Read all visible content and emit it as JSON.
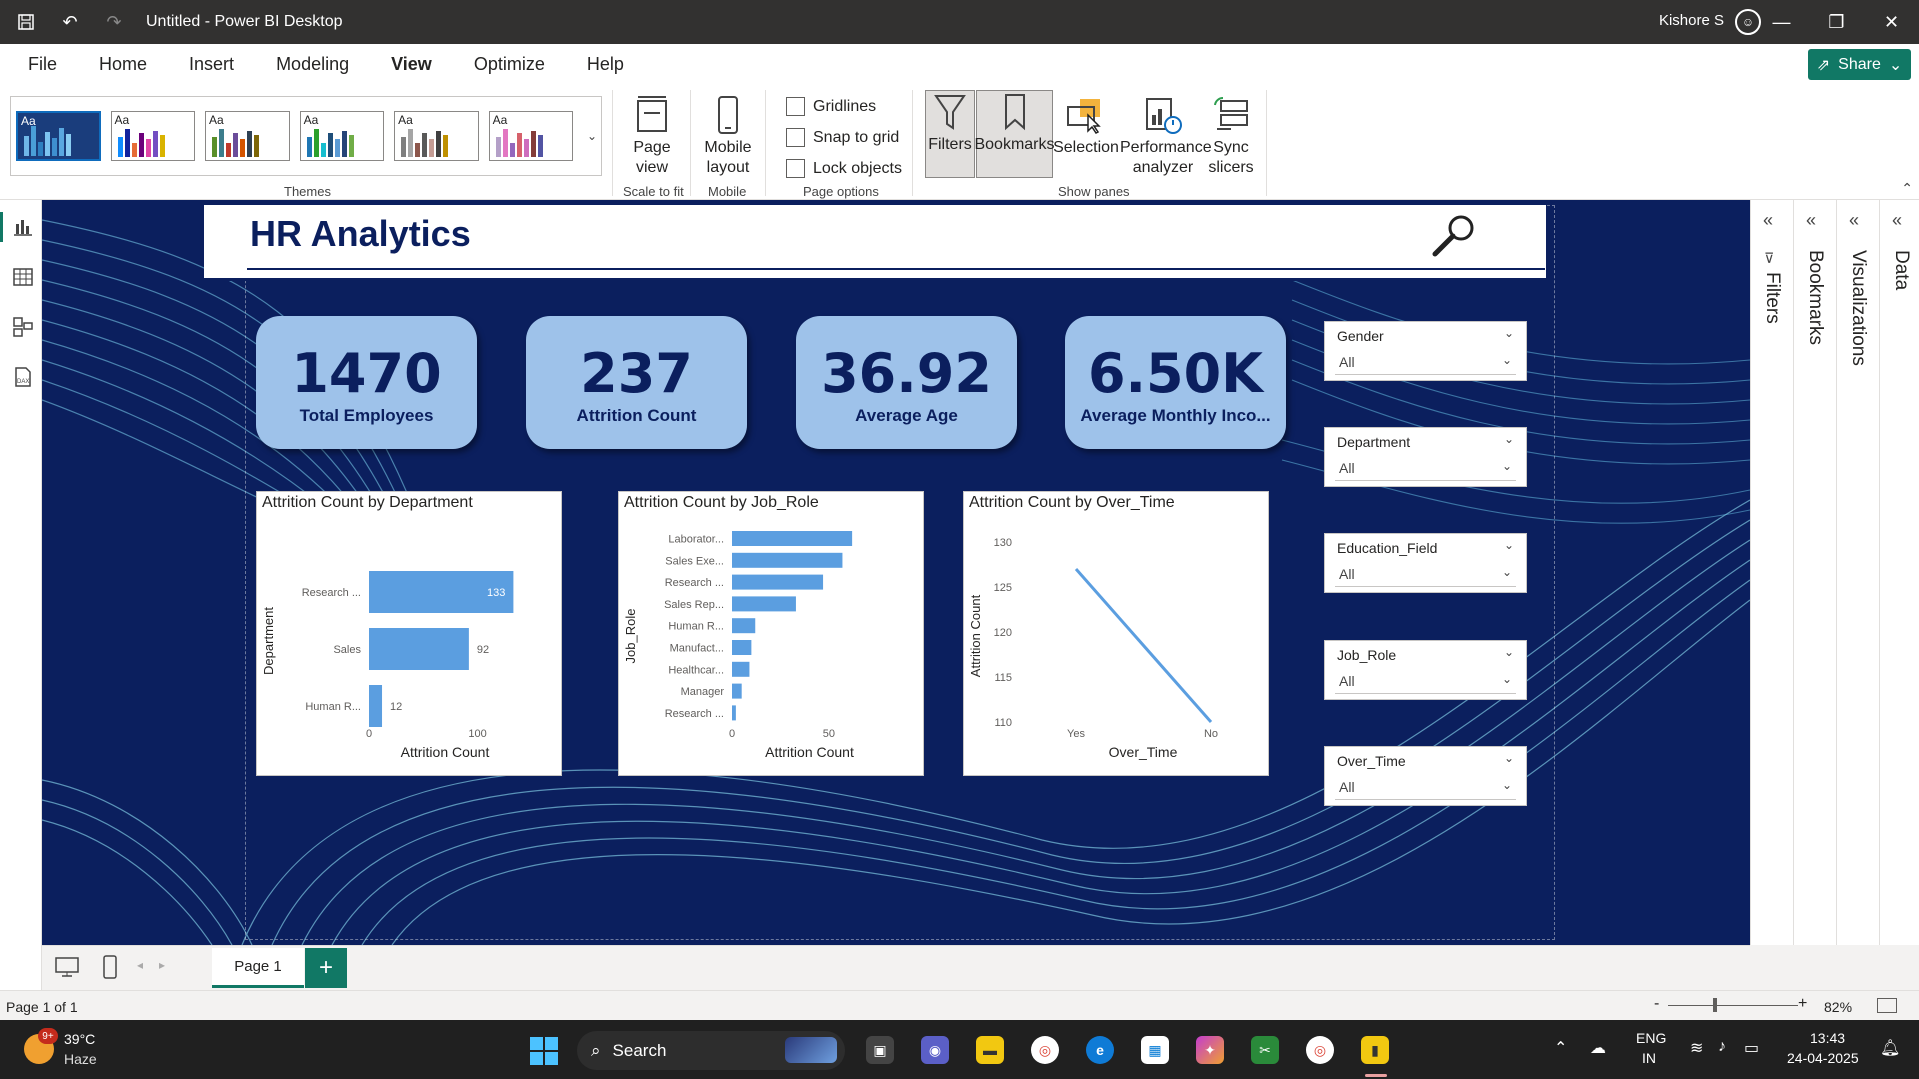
{
  "titlebar": {
    "title": "Untitled - Power BI Desktop",
    "user": "Kishore S",
    "minimize": "—",
    "restore": "❐",
    "close": "✕"
  },
  "menu": {
    "items": [
      "File",
      "Home",
      "Insert",
      "Modeling",
      "View",
      "Optimize",
      "Help"
    ],
    "active": "View",
    "share": "Share"
  },
  "ribbon": {
    "themes_label": "Themes",
    "page_view": "Page view",
    "scale_to_fit": "Scale to fit",
    "mobile_layout": "Mobile layout",
    "mobile": "Mobile",
    "gridlines": "Gridlines",
    "snap_to_grid": "Snap to grid",
    "lock_objects": "Lock objects",
    "page_options": "Page options",
    "filters": "Filters",
    "bookmarks": "Bookmarks",
    "selection": "Selection",
    "performance_analyzer": "Performance analyzer",
    "sync_slicers": "Sync slicers",
    "show_panes": "Show panes"
  },
  "report": {
    "title": "HR Analytics",
    "kpis": [
      {
        "value": "1470",
        "label": "Total Employees"
      },
      {
        "value": "237",
        "label": "Attrition Count"
      },
      {
        "value": "36.92",
        "label": "Average Age"
      },
      {
        "value": "6.50K",
        "label": "Average Monthly Inco..."
      }
    ],
    "slicers": [
      {
        "title": "Gender",
        "value": "All"
      },
      {
        "title": "Department",
        "value": "All"
      },
      {
        "title": "Education_Field",
        "value": "All"
      },
      {
        "title": "Job_Role",
        "value": "All"
      },
      {
        "title": "Over_Time",
        "value": "All"
      }
    ]
  },
  "chart_data": [
    {
      "type": "bar",
      "title": "Attrition Count by Department",
      "xlabel": "Attrition Count",
      "ylabel": "Department",
      "categories": [
        "Research ...",
        "Sales",
        "Human R..."
      ],
      "values": [
        133,
        92,
        12
      ],
      "xticks": [
        "0",
        "100"
      ],
      "xlim": [
        0,
        140
      ],
      "color": "#5b9ee0"
    },
    {
      "type": "bar",
      "title": "Attrition Count by Job_Role",
      "xlabel": "Attrition Count",
      "ylabel": "Job_Role",
      "categories": [
        "Laborator...",
        "Sales Exe...",
        "Research ...",
        "Sales Rep...",
        "Human R...",
        "Manufact...",
        "Healthcar...",
        "Manager",
        "Research ..."
      ],
      "values": [
        62,
        57,
        47,
        33,
        12,
        10,
        9,
        5,
        2
      ],
      "xticks": [
        "0",
        "50"
      ],
      "xlim": [
        0,
        80
      ],
      "color": "#5b9ee0"
    },
    {
      "type": "line",
      "title": "Attrition Count by Over_Time",
      "xlabel": "Over_Time",
      "ylabel": "Attrition Count",
      "categories": [
        "Yes",
        "No"
      ],
      "values": [
        127,
        110
      ],
      "yticks": [
        "130",
        "125",
        "120",
        "115",
        "110"
      ],
      "ylim": [
        110,
        130
      ],
      "color": "#5b9ee0"
    }
  ],
  "panes": {
    "filters": "Filters",
    "bookmarks": "Bookmarks",
    "visualizations": "Visualizations",
    "data": "Data"
  },
  "pages": {
    "tab": "Page 1",
    "add": "+",
    "status": "Page 1 of 1",
    "zoom": "82%"
  },
  "taskbar": {
    "weather_temp": "39°C",
    "weather_desc": "Haze",
    "weather_badge": "9+",
    "search": "Search",
    "lang1": "ENG",
    "lang2": "IN",
    "time": "13:43",
    "date": "24-04-2025"
  }
}
